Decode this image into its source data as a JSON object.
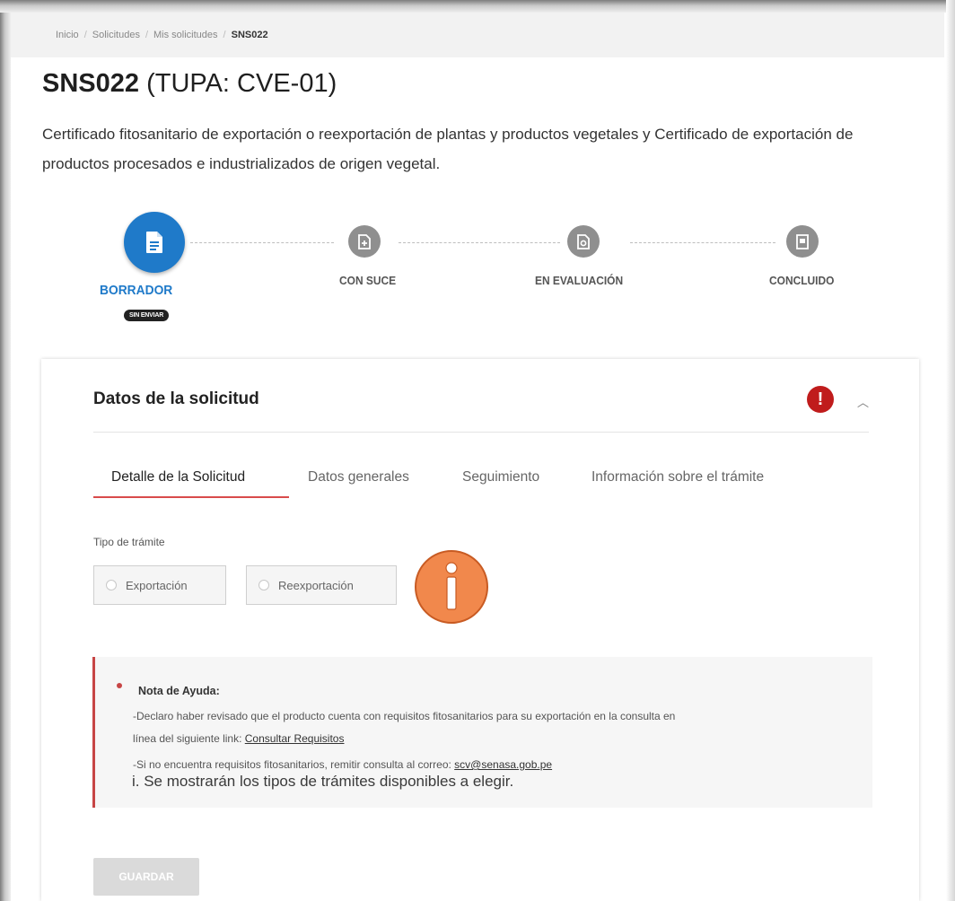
{
  "breadcrumb": {
    "items": [
      "Inicio",
      "Solicitudes",
      "Mis solicitudes"
    ],
    "current": "SNS022"
  },
  "page": {
    "code": "SNS022",
    "tupa": "(TUPA: CVE-01)",
    "description": "Certificado fitosanitario de exportación o reexportación de plantas y productos vegetales y Certificado de exportación de productos procesados e industrializados de origen vegetal."
  },
  "stepper": {
    "steps": [
      {
        "label": "BORRADOR",
        "icon": "document-icon",
        "active": true
      },
      {
        "label": "CON SUCE",
        "icon": "add-document-icon",
        "active": false
      },
      {
        "label": "EN EVALUACIÓN",
        "icon": "search-document-icon",
        "active": false
      },
      {
        "label": "CONCLUIDO",
        "icon": "certificate-icon",
        "active": false
      }
    ],
    "status_badge": "SIN ENVIAR"
  },
  "section": {
    "title": "Datos de la solicitud",
    "alert_icon": "!",
    "collapse_icon": "^"
  },
  "tabs": [
    {
      "label": "Detalle de la Solicitud",
      "active": true
    },
    {
      "label": "Datos generales",
      "active": false
    },
    {
      "label": "Seguimiento",
      "active": false
    },
    {
      "label": "Información sobre el trámite",
      "active": false
    }
  ],
  "form": {
    "tipo_label": "Tipo de trámite",
    "options": [
      "Exportación",
      "Reexportación"
    ]
  },
  "help": {
    "title": "Nota de Ayuda:",
    "line1": "-Declaro haber revisado que el producto cuenta con requisitos fitosanitarios para su exportación en la consulta en",
    "line2": "línea del siguiente link:",
    "link": "Consultar Requisitos",
    "line3": "-Si no encuentra requisitos fitosanitarios, remitir consulta al correo:",
    "email": "scv@senasa.gob.pe"
  },
  "annotation": "i. Se mostrarán los tipos de trámites disponibles a elegir.",
  "actions": {
    "save": "GUARDAR"
  },
  "colors": {
    "primary": "#1f7ac9",
    "tab_active": "#d94b4b",
    "alert": "#c01c1c",
    "info_marker": "#f1884c"
  }
}
